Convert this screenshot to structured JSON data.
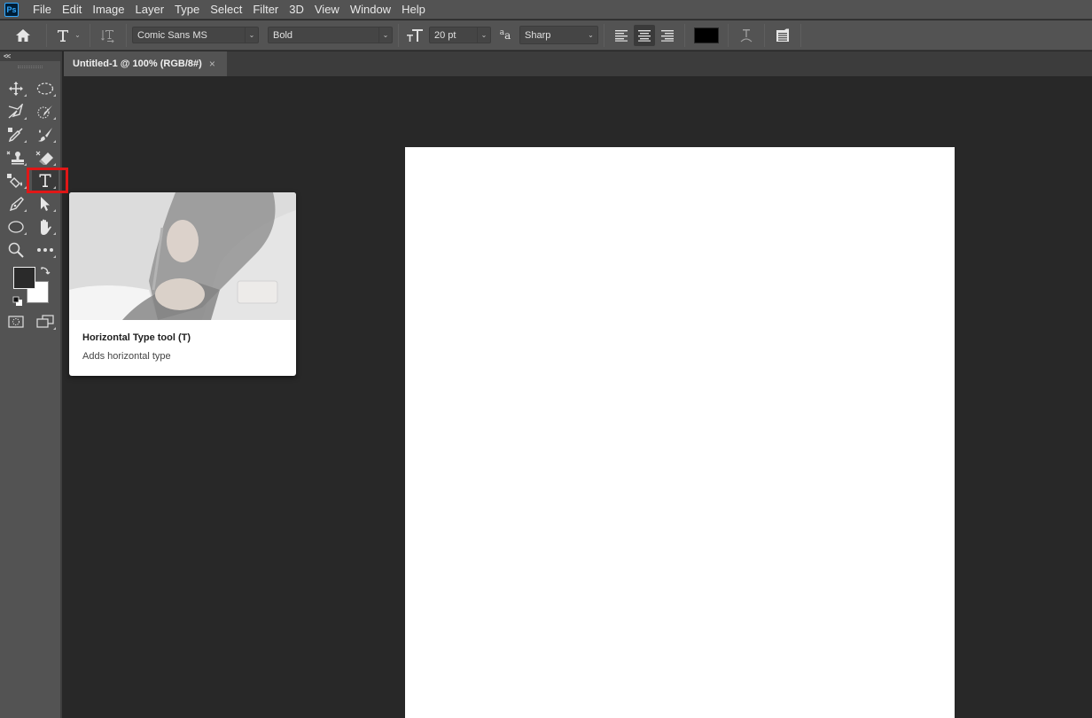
{
  "app": {
    "logo": "Ps",
    "name": "Photoshop"
  },
  "menubar": {
    "items": [
      "File",
      "Edit",
      "Image",
      "Layer",
      "Type",
      "Select",
      "Filter",
      "3D",
      "View",
      "Window",
      "Help"
    ]
  },
  "options_bar": {
    "home_icon": "home-icon",
    "tool_preset_icon": "type-tool-icon",
    "orientation_icon": "toggle-text-orientation-icon",
    "font_family": "Comic Sans MS",
    "font_style": "Bold",
    "font_size_icon": "font-size-icon",
    "font_size": "20 pt",
    "antialias_icon": "anti-aliasing-icon",
    "antialias": "Sharp",
    "alignment": {
      "options": [
        "left",
        "center",
        "right"
      ],
      "selected": "center"
    },
    "text_color": "#000000",
    "warp_icon": "warp-text-icon",
    "panels_icon": "character-paragraph-panels-icon"
  },
  "document_tab": {
    "title": "Untitled-1 @ 100% (RGB/8#)",
    "close": "×"
  },
  "toolbox": {
    "collapse_label": "<<",
    "tools": [
      {
        "name": "move-tool",
        "icon": "move-icon"
      },
      {
        "name": "elliptical-marquee-tool",
        "icon": "ellipse-marquee-icon"
      },
      {
        "name": "polygonal-lasso-tool",
        "icon": "lasso-icon"
      },
      {
        "name": "quick-selection-tool",
        "icon": "quick-selection-icon"
      },
      {
        "name": "eyedropper-tool",
        "icon": "eyedropper-icon"
      },
      {
        "name": "brush-tool",
        "icon": "brush-icon"
      },
      {
        "name": "clone-stamp-tool",
        "icon": "stamp-icon"
      },
      {
        "name": "eraser-tool",
        "icon": "eraser-icon"
      },
      {
        "name": "paint-bucket-tool",
        "icon": "paint-bucket-icon"
      },
      {
        "name": "horizontal-type-tool",
        "icon": "type-icon",
        "active": true
      },
      {
        "name": "pen-tool",
        "icon": "pen-icon"
      },
      {
        "name": "path-selection-tool",
        "icon": "arrow-icon"
      },
      {
        "name": "ellipse-tool",
        "icon": "ellipse-icon"
      },
      {
        "name": "hand-tool",
        "icon": "hand-icon"
      },
      {
        "name": "zoom-tool",
        "icon": "zoom-icon"
      },
      {
        "name": "edit-toolbar",
        "icon": "more-icon"
      }
    ],
    "foreground_color": "#2a2a2a",
    "background_color": "#ffffff"
  },
  "tooltip": {
    "title": "Horizontal Type tool (T)",
    "description": "Adds horizontal type"
  },
  "canvas": {
    "background": "#ffffff"
  }
}
